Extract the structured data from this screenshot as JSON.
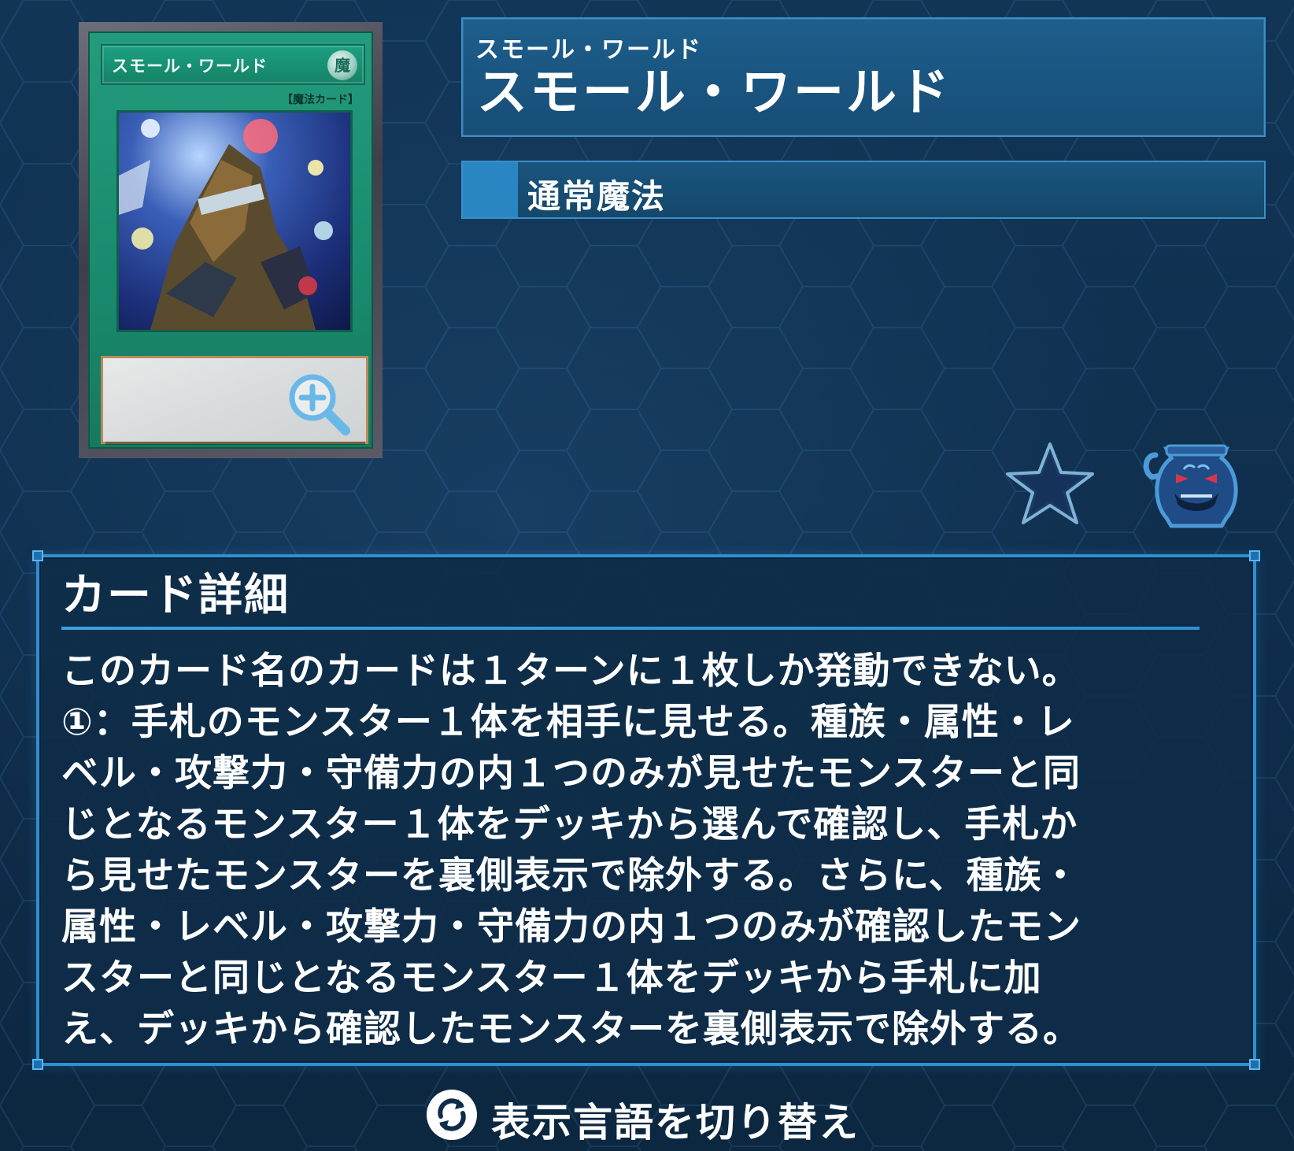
{
  "card": {
    "name_on_card": "スモール・ワールド",
    "attribute_glyph": "魔",
    "type_line": "【魔法カード】"
  },
  "title": {
    "ruby": "スモール・ワールド",
    "name": "スモール・ワールド"
  },
  "card_type": "通常魔法",
  "details": {
    "heading": "カード詳細",
    "lines": [
      "このカード名のカードは１ターンに１枚しか発動できない。",
      "①：手札のモンスター１体を相手に見せる。種族・属性・レ",
      "ベル・攻撃力・守備力の内１つのみが見せたモンスターと同",
      "じとなるモンスター１体をデッキから選んで確認し、手札か",
      "ら見せたモンスターを裏側表示で除外する。さらに、種族・",
      "属性・レベル・攻撃力・守備力の内１つのみが確認したモン",
      "スターと同じとなるモンスター１体をデッキから手札に加",
      "え、デッキから確認したモンスターを裏側表示で除外する。"
    ]
  },
  "lang_toggle": {
    "label": "表示言語を切り替え"
  },
  "icons": {
    "zoom": "zoom-in-icon",
    "favorite": "star-icon",
    "pot": "pot-of-greed-icon",
    "language": "refresh-icon"
  },
  "colors": {
    "background": "#0f2d4a",
    "panel_border": "#2f8fd0",
    "title_panel": "#1d5e8c",
    "type_chip": "#2a86c3",
    "spell_card_green": "#1a8a6d"
  }
}
